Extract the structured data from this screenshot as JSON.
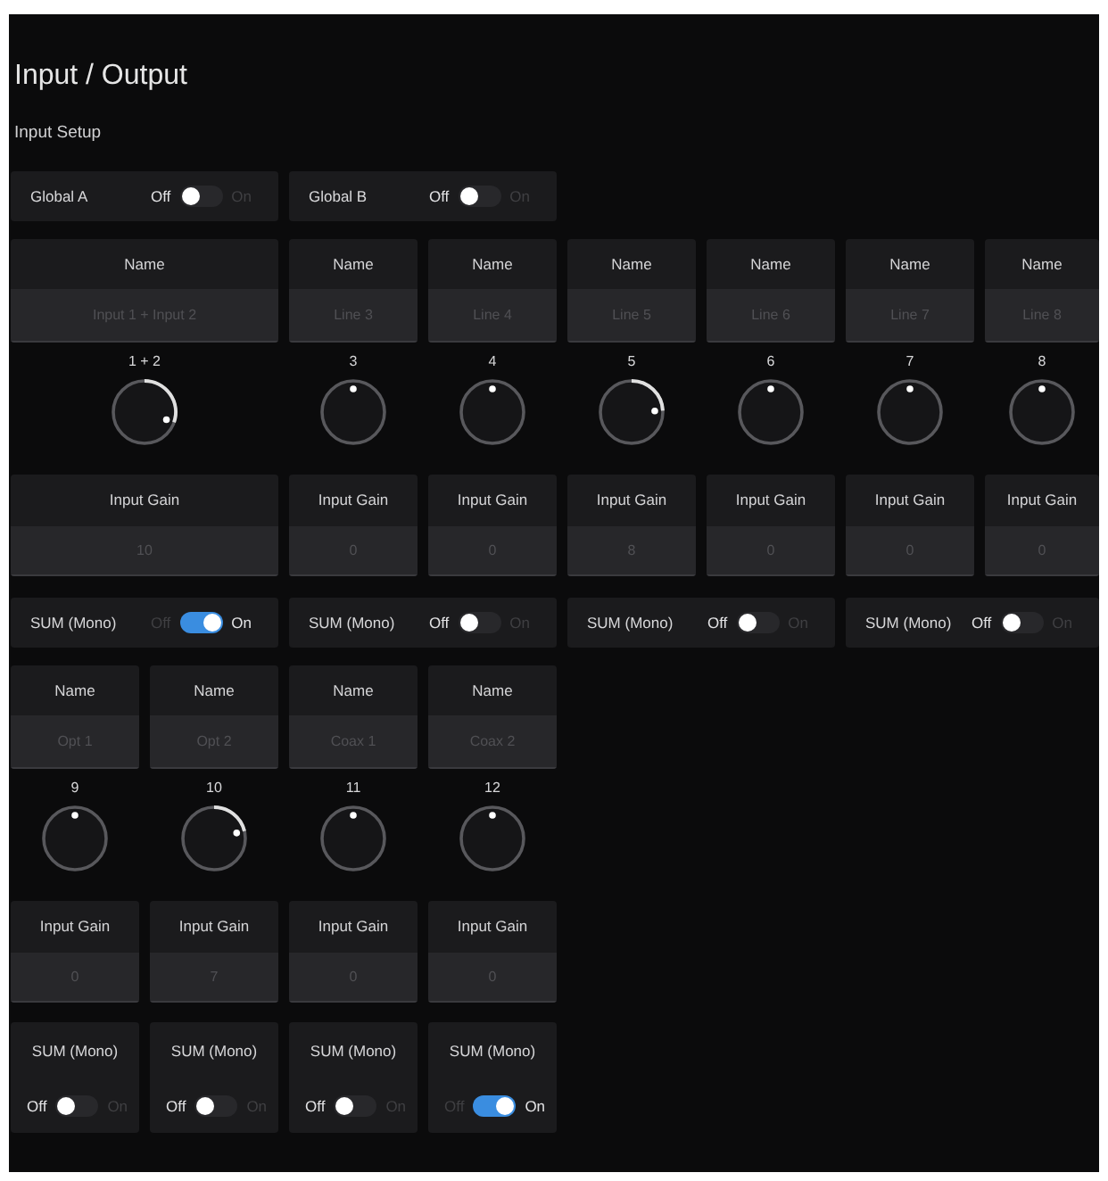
{
  "page": {
    "title": "Input / Output",
    "section": "Input Setup"
  },
  "globals": [
    {
      "label": "Global A",
      "off_label": "Off",
      "on_label": "On",
      "on": false
    },
    {
      "label": "Global B",
      "off_label": "Off",
      "on_label": "On",
      "on": false
    }
  ],
  "groups": [
    {
      "channels": [
        {
          "kind": "stereo",
          "name_label": "Name",
          "name": "Input 1 + Input 2",
          "number": "1 + 2",
          "gain_label": "Input Gain",
          "gain": "10"
        },
        {
          "kind": "mono",
          "name_label": "Name",
          "name": "Line 3",
          "number": "3",
          "gain_label": "Input Gain",
          "gain": "0"
        },
        {
          "kind": "mono",
          "name_label": "Name",
          "name": "Line 4",
          "number": "4",
          "gain_label": "Input Gain",
          "gain": "0"
        },
        {
          "kind": "mono",
          "name_label": "Name",
          "name": "Line 5",
          "number": "5",
          "gain_label": "Input Gain",
          "gain": "8"
        },
        {
          "kind": "mono",
          "name_label": "Name",
          "name": "Line 6",
          "number": "6",
          "gain_label": "Input Gain",
          "gain": "0"
        },
        {
          "kind": "mono",
          "name_label": "Name",
          "name": "Line 7",
          "number": "7",
          "gain_label": "Input Gain",
          "gain": "0"
        },
        {
          "kind": "mono",
          "name_label": "Name",
          "name": "Line 8",
          "number": "8",
          "gain_label": "Input Gain",
          "gain": "0"
        }
      ],
      "sums": [
        {
          "kind": "inline",
          "label": "SUM (Mono)",
          "off_label": "Off",
          "on_label": "On",
          "on": true
        },
        {
          "kind": "inline",
          "label": "SUM (Mono)",
          "off_label": "Off",
          "on_label": "On",
          "on": false
        },
        {
          "kind": "inline",
          "label": "SUM (Mono)",
          "off_label": "Off",
          "on_label": "On",
          "on": false
        },
        {
          "kind": "inline",
          "label": "SUM (Mono)",
          "off_label": "Off",
          "on_label": "On",
          "on": false
        }
      ]
    },
    {
      "channels": [
        {
          "kind": "mono",
          "name_label": "Name",
          "name": "Opt 1",
          "number": "9",
          "gain_label": "Input Gain",
          "gain": "0"
        },
        {
          "kind": "mono",
          "name_label": "Name",
          "name": "Opt 2",
          "number": "10",
          "gain_label": "Input Gain",
          "gain": "7"
        },
        {
          "kind": "mono",
          "name_label": "Name",
          "name": "Coax 1",
          "number": "11",
          "gain_label": "Input Gain",
          "gain": "0"
        },
        {
          "kind": "mono",
          "name_label": "Name",
          "name": "Coax 2",
          "number": "12",
          "gain_label": "Input Gain",
          "gain": "0"
        }
      ],
      "sums": [
        {
          "kind": "stacked",
          "label": "SUM (Mono)",
          "off_label": "Off",
          "on_label": "On",
          "on": false
        },
        {
          "kind": "stacked",
          "label": "SUM (Mono)",
          "off_label": "Off",
          "on_label": "On",
          "on": false
        },
        {
          "kind": "stacked",
          "label": "SUM (Mono)",
          "off_label": "Off",
          "on_label": "On",
          "on": false
        },
        {
          "kind": "stacked",
          "label": "SUM (Mono)",
          "off_label": "Off",
          "on_label": "On",
          "on": true
        }
      ]
    }
  ]
}
